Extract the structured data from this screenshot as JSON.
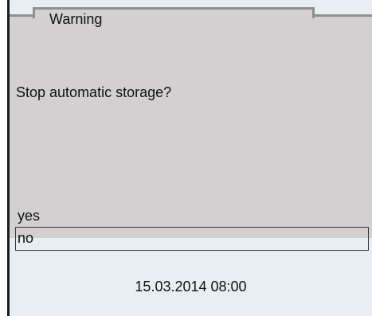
{
  "dialog": {
    "title": "Warning",
    "message": "Stop automatic storage?",
    "options": [
      {
        "label": "yes",
        "selected": false
      },
      {
        "label": "no",
        "selected": true
      }
    ]
  },
  "status_bar": {
    "datetime": "15.03.2014 08:00"
  },
  "colors": {
    "dialog_background": "#d2d0d1",
    "screen_background": "#e9eef3",
    "frame_border": "#8f8f8f"
  }
}
